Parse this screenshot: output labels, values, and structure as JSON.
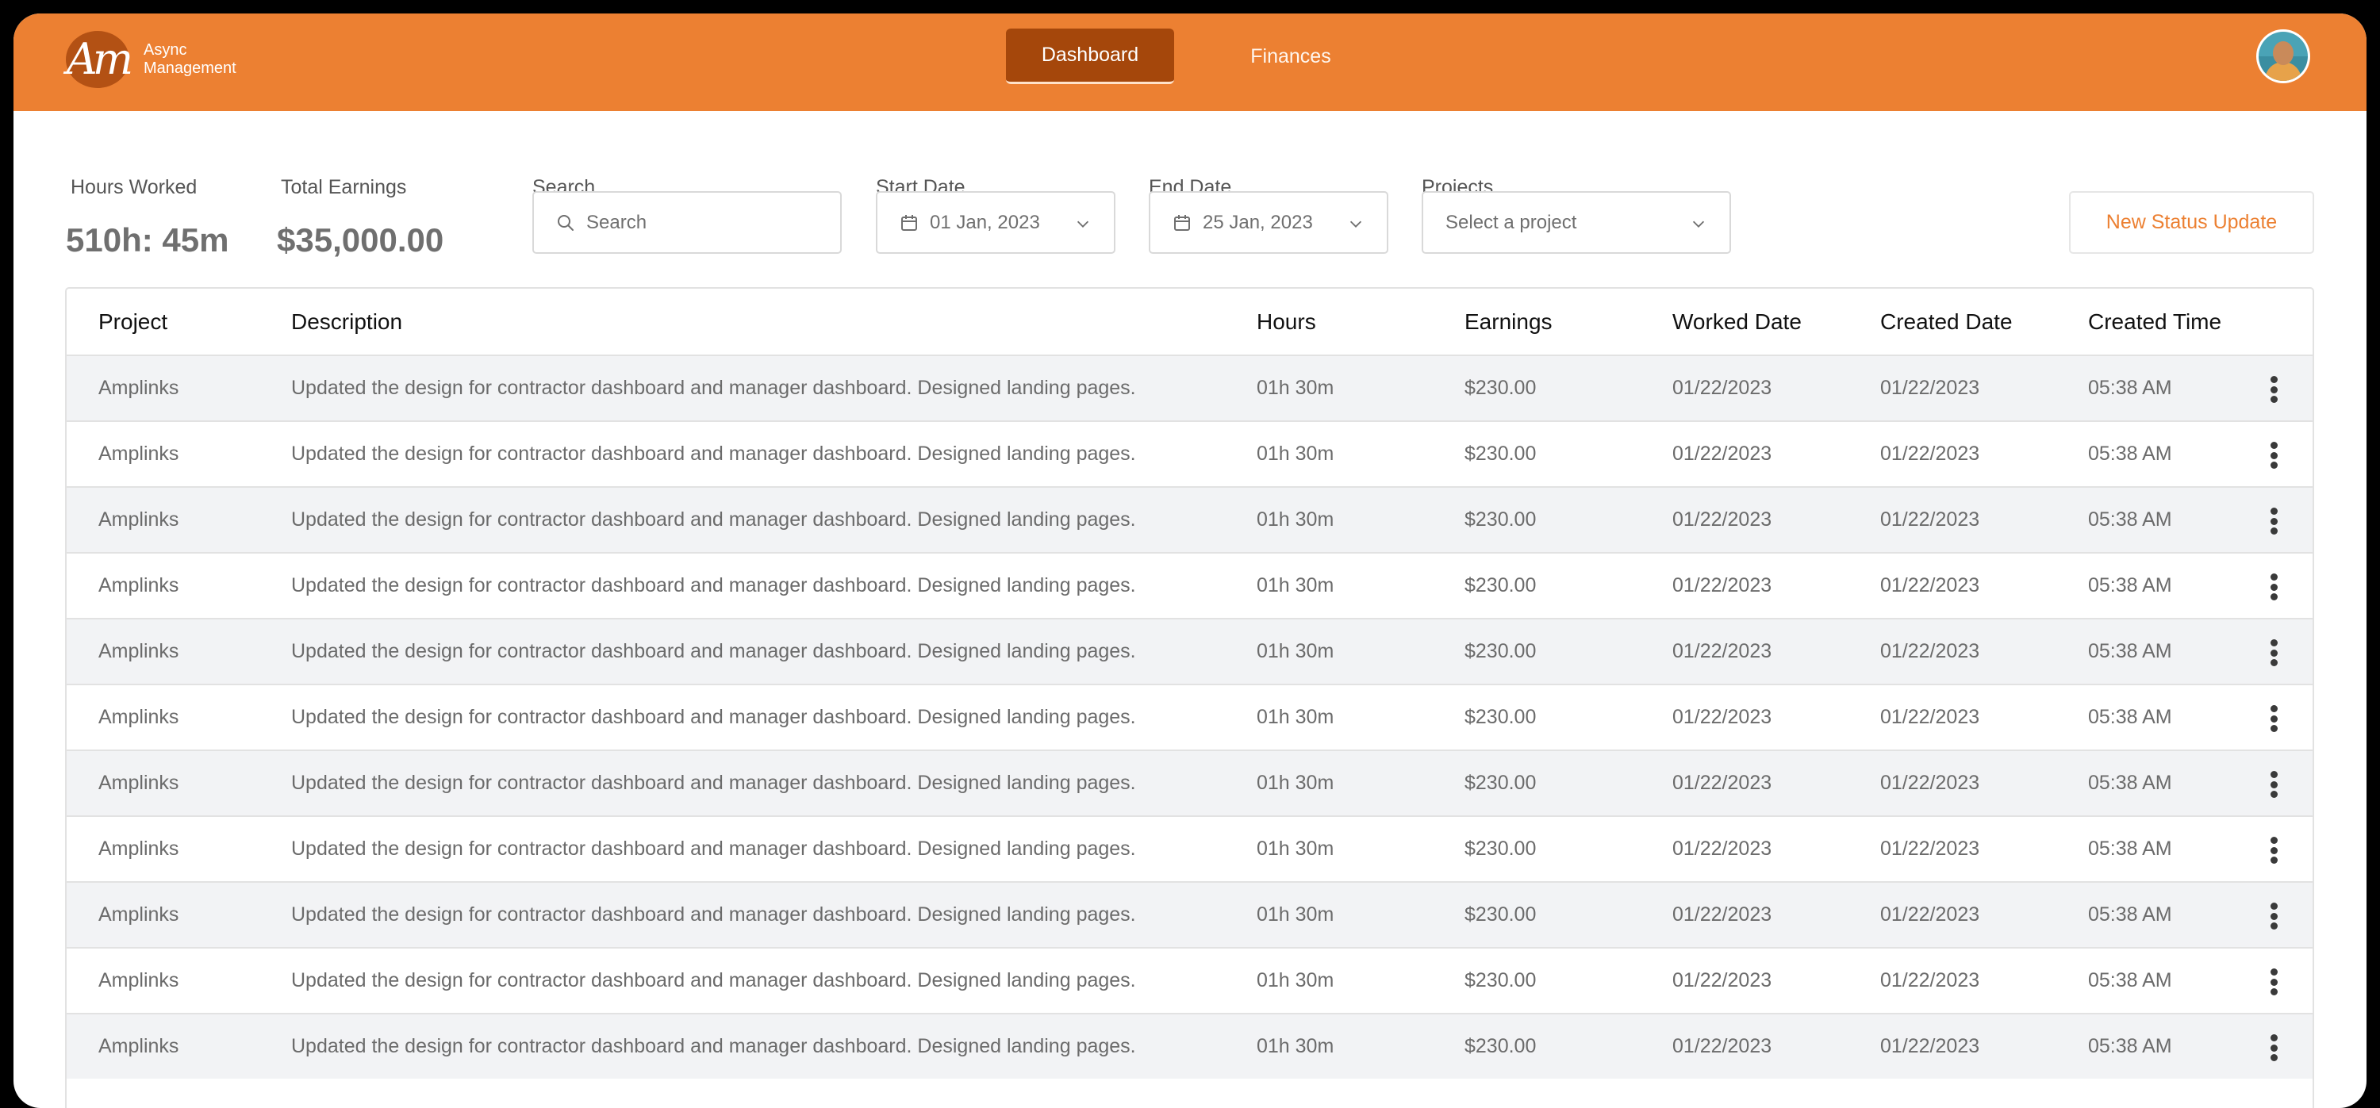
{
  "header": {
    "logo_line1": "Async",
    "logo_line2": "Management",
    "tabs": [
      {
        "label": "Dashboard",
        "active": true
      },
      {
        "label": "Finances",
        "active": false
      }
    ],
    "accent_color": "#ec8032"
  },
  "stats": {
    "hours_label": "Hours Worked",
    "hours_value": "510h: 45m",
    "earnings_label": "Total Earnings",
    "earnings_value": "$35,000.00"
  },
  "filters": {
    "search_label": "Search",
    "search_placeholder": "Search",
    "start_label": "Start Date",
    "start_value": "01 Jan, 2023",
    "end_label": "End Date",
    "end_value": "25 Jan, 2023",
    "projects_label": "Projects",
    "projects_value": "Select a project"
  },
  "actions": {
    "new_status_label": "New Status Update"
  },
  "table": {
    "columns": [
      "Project",
      "Description",
      "Hours",
      "Earnings",
      "Worked Date",
      "Created Date",
      "Created Time"
    ],
    "rows": [
      {
        "project": "Amplinks",
        "description": "Updated the design for contractor dashboard and manager dashboard. Designed landing pages.",
        "hours": "01h 30m",
        "earnings": "$230.00",
        "worked_date": "01/22/2023",
        "created_date": "01/22/2023",
        "created_time": "05:38 AM"
      },
      {
        "project": "Amplinks",
        "description": "Updated the design for contractor dashboard and manager dashboard. Designed landing pages.",
        "hours": "01h 30m",
        "earnings": "$230.00",
        "worked_date": "01/22/2023",
        "created_date": "01/22/2023",
        "created_time": "05:38 AM"
      },
      {
        "project": "Amplinks",
        "description": "Updated the design for contractor dashboard and manager dashboard. Designed landing pages.",
        "hours": "01h 30m",
        "earnings": "$230.00",
        "worked_date": "01/22/2023",
        "created_date": "01/22/2023",
        "created_time": "05:38 AM"
      },
      {
        "project": "Amplinks",
        "description": "Updated the design for contractor dashboard and manager dashboard. Designed landing pages.",
        "hours": "01h 30m",
        "earnings": "$230.00",
        "worked_date": "01/22/2023",
        "created_date": "01/22/2023",
        "created_time": "05:38 AM"
      },
      {
        "project": "Amplinks",
        "description": "Updated the design for contractor dashboard and manager dashboard. Designed landing pages.",
        "hours": "01h 30m",
        "earnings": "$230.00",
        "worked_date": "01/22/2023",
        "created_date": "01/22/2023",
        "created_time": "05:38 AM"
      },
      {
        "project": "Amplinks",
        "description": "Updated the design for contractor dashboard and manager dashboard. Designed landing pages.",
        "hours": "01h 30m",
        "earnings": "$230.00",
        "worked_date": "01/22/2023",
        "created_date": "01/22/2023",
        "created_time": "05:38 AM"
      },
      {
        "project": "Amplinks",
        "description": "Updated the design for contractor dashboard and manager dashboard. Designed landing pages.",
        "hours": "01h 30m",
        "earnings": "$230.00",
        "worked_date": "01/22/2023",
        "created_date": "01/22/2023",
        "created_time": "05:38 AM"
      },
      {
        "project": "Amplinks",
        "description": "Updated the design for contractor dashboard and manager dashboard. Designed landing pages.",
        "hours": "01h 30m",
        "earnings": "$230.00",
        "worked_date": "01/22/2023",
        "created_date": "01/22/2023",
        "created_time": "05:38 AM"
      },
      {
        "project": "Amplinks",
        "description": "Updated the design for contractor dashboard and manager dashboard. Designed landing pages.",
        "hours": "01h 30m",
        "earnings": "$230.00",
        "worked_date": "01/22/2023",
        "created_date": "01/22/2023",
        "created_time": "05:38 AM"
      },
      {
        "project": "Amplinks",
        "description": "Updated the design for contractor dashboard and manager dashboard. Designed landing pages.",
        "hours": "01h 30m",
        "earnings": "$230.00",
        "worked_date": "01/22/2023",
        "created_date": "01/22/2023",
        "created_time": "05:38 AM"
      },
      {
        "project": "Amplinks",
        "description": "Updated the design for contractor dashboard and manager dashboard. Designed landing pages.",
        "hours": "01h 30m",
        "earnings": "$230.00",
        "worked_date": "01/22/2023",
        "created_date": "01/22/2023",
        "created_time": "05:38 AM"
      }
    ]
  }
}
